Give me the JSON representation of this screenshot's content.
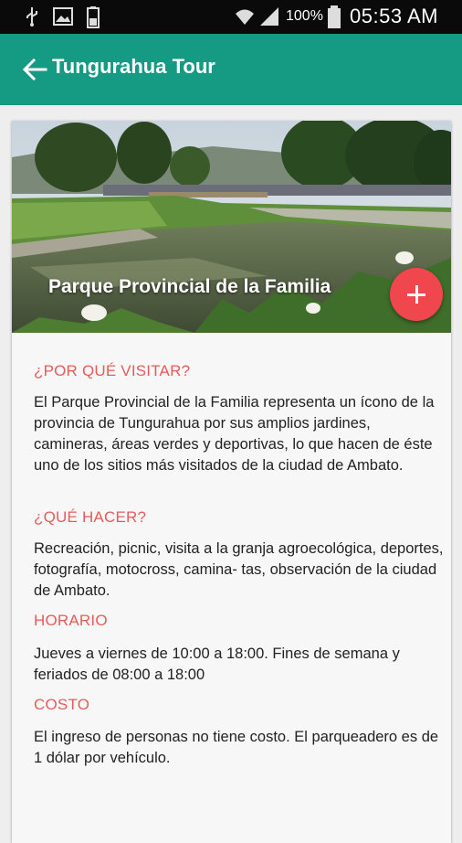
{
  "status_bar": {
    "battery_percent": "100%",
    "time": "05:53 AM",
    "icons": [
      "usb-icon",
      "image-icon",
      "battery-small-icon",
      "wifi-icon",
      "signal-icon",
      "battery-icon"
    ]
  },
  "toolbar": {
    "title": "Tungurahua Tour",
    "back_icon": "arrow-left-icon"
  },
  "hero": {
    "title": "Parque Provincial de la Familia",
    "fab_icon": "plus-icon"
  },
  "sections": [
    {
      "heading": "¿POR QUÉ VISITAR?",
      "body": "El Parque Provincial de la Familia representa un ícono de la provincia de Tungurahua por sus amplios jardines, camineras, áreas verdes y deportivas, lo que hacen de éste uno de los sitios más visitados de la ciudad de Ambato."
    },
    {
      "heading": "¿QUÉ HACER?",
      "body": "Recreación, picnic, visita a la granja agroecológica, deportes, fotografía, motocross, camina- tas, observación de la ciudad de Ambato."
    },
    {
      "heading": "HORARIO",
      "body": "Jueves a viernes de 10:00 a 18:00. Fines de semana y feriados de 08:00 a 18:00"
    },
    {
      "heading": "COSTO",
      "body": "El ingreso de personas no tiene costo. El parqueadero es de 1 dólar por vehículo."
    }
  ],
  "colors": {
    "toolbar": "#159a84",
    "heading": "#e65b5b",
    "fab": "#f0474e"
  }
}
